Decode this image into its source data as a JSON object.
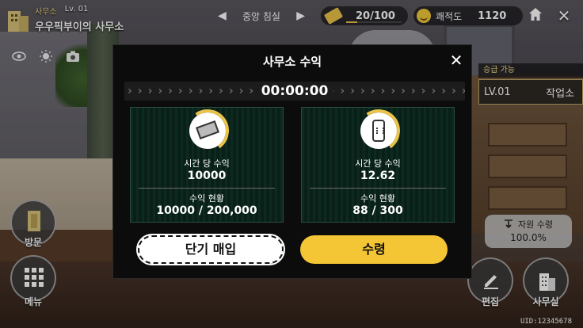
{
  "office": {
    "type_label": "사무소",
    "level": "Lv. 01",
    "name": "우우픽부이의 사무소"
  },
  "room_nav": {
    "prev": "◀",
    "room_name": "중앙 침실",
    "next": "▶"
  },
  "energy": {
    "value": "20/100",
    "fill_fraction": 0.2,
    "color": "#e9c34a"
  },
  "comfort": {
    "label": "쾌적도",
    "value": "1120"
  },
  "top_icons": {
    "home": "home-icon",
    "close": "✕"
  },
  "view_icons": [
    "eye-icon",
    "sun-icon",
    "camera-icon"
  ],
  "side_panel": {
    "promo_label": "승급 가능",
    "level": "LV.01",
    "building": "작업소"
  },
  "resource": {
    "label": "자원 수령",
    "value": "100.0%"
  },
  "bottom_buttons": {
    "visit": "방문",
    "menu": "메뉴",
    "edit": "편집",
    "office": "사무실"
  },
  "uid": "UID:12345678",
  "modal": {
    "title": "사무소 수익",
    "close": "✕",
    "timer": "00:00:00",
    "left_card": {
      "rate_label": "시간 당 수익",
      "rate_value": "10000",
      "status_label": "수익 현황",
      "status_value": "10000 / 200,000"
    },
    "right_card": {
      "rate_label": "시간 당 수익",
      "rate_value": "12.62",
      "status_label": "수익 현황",
      "status_value": "88 / 300"
    },
    "buy_button": "단기 매입",
    "claim_button": "수령"
  },
  "colors": {
    "accent_yellow": "#f4c534",
    "card_green": "#0d2a20",
    "modal_bg": "#0c0c0c"
  }
}
